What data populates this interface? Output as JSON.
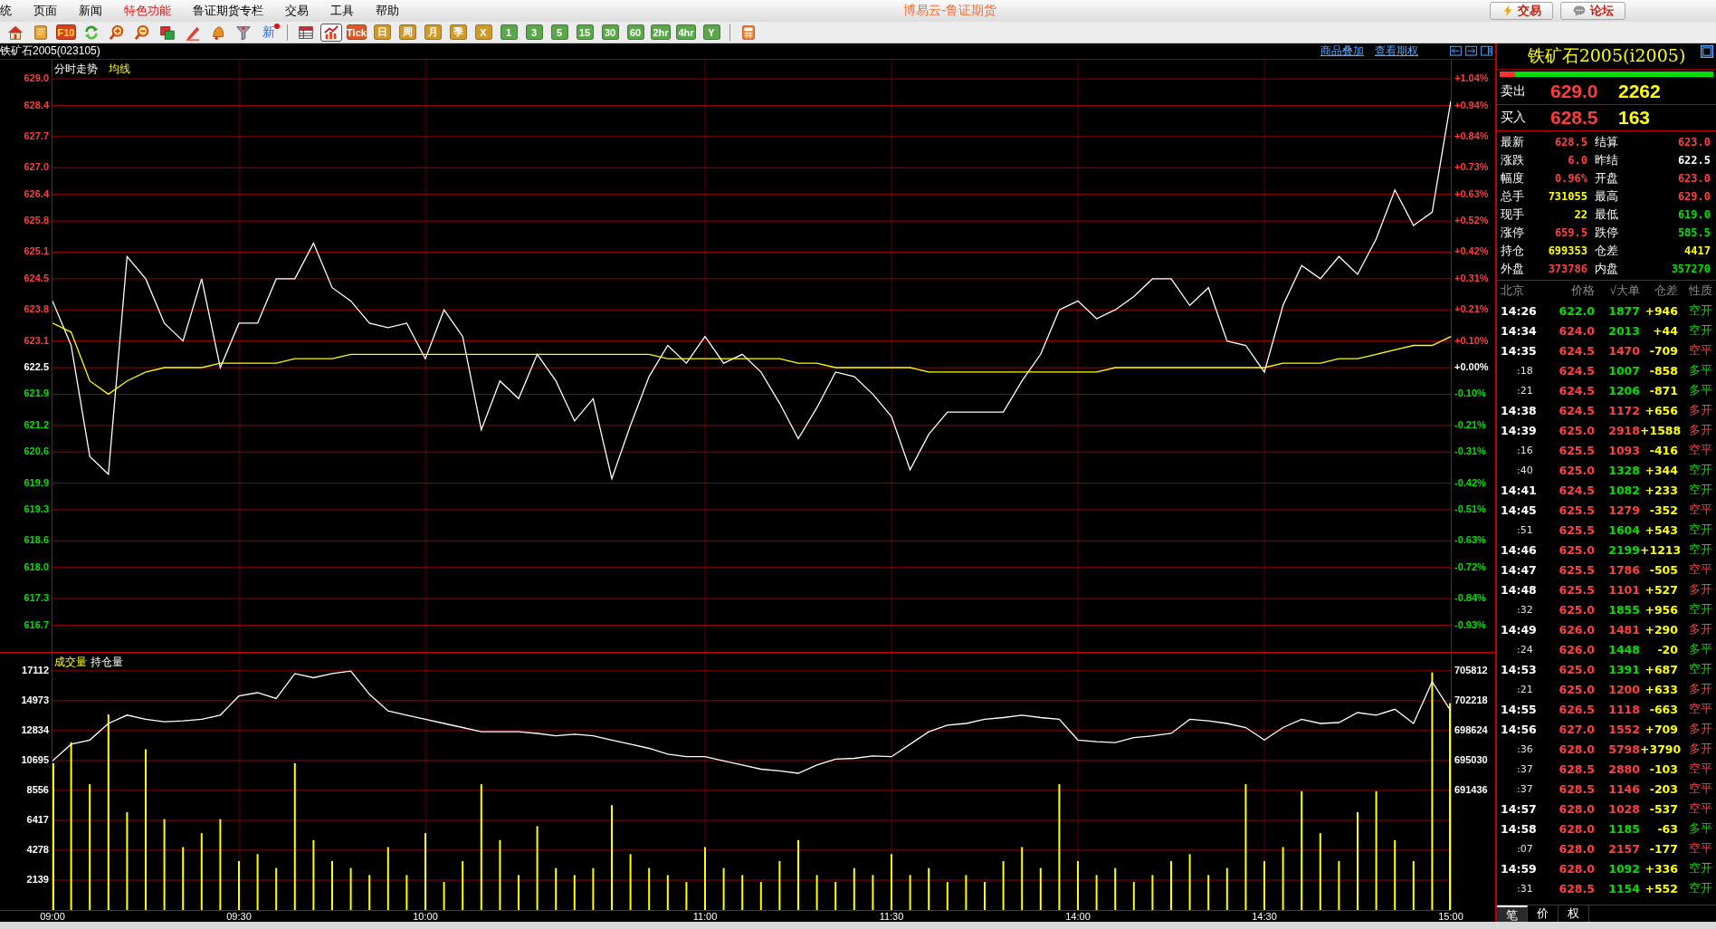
{
  "menu": [
    {
      "label": "统",
      "selected": false
    },
    {
      "label": "页面",
      "selected": false
    },
    {
      "label": "新闻",
      "selected": false
    },
    {
      "label": "特色功能",
      "selected": true
    },
    {
      "label": "鲁证期货专栏",
      "selected": false
    },
    {
      "label": "交易",
      "selected": false
    },
    {
      "label": "工具",
      "selected": false
    },
    {
      "label": "帮助",
      "selected": false
    }
  ],
  "app_title": "博易云-鲁证期货",
  "top_buttons": [
    {
      "kind": "trade",
      "label": "交易"
    },
    {
      "kind": "forum",
      "label": "论坛"
    }
  ],
  "toolbar": [
    {
      "kind": "icon",
      "selected": false
    },
    {
      "kind": "icon",
      "selected": false
    },
    {
      "kind": "f10",
      "label": "F10",
      "selected": false
    },
    {
      "kind": "icon",
      "selected": false
    },
    {
      "kind": "icon",
      "selected": false
    },
    {
      "kind": "icon",
      "selected": false
    },
    {
      "kind": "icon",
      "selected": false
    },
    {
      "kind": "icon",
      "selected": false
    },
    {
      "kind": "icon",
      "selected": false
    },
    {
      "kind": "icon",
      "selected": false
    },
    {
      "kind": "new",
      "label": "新",
      "selected": false
    },
    {
      "kind": "separator"
    },
    {
      "kind": "icon",
      "selected": false
    },
    {
      "kind": "icon",
      "selected": true
    },
    {
      "kind": "tick",
      "label": "Tick",
      "selected": false
    },
    {
      "kind": "period",
      "label": "日",
      "selected": false
    },
    {
      "kind": "period",
      "label": "周",
      "selected": false
    },
    {
      "kind": "period",
      "label": "月",
      "selected": false
    },
    {
      "kind": "period",
      "label": "季",
      "selected": false
    },
    {
      "kind": "period",
      "label": "X",
      "selected": false
    },
    {
      "kind": "minute",
      "label": "1",
      "selected": false
    },
    {
      "kind": "minute",
      "label": "3",
      "selected": false
    },
    {
      "kind": "minute",
      "label": "5",
      "selected": false
    },
    {
      "kind": "minute",
      "label": "15",
      "selected": false
    },
    {
      "kind": "minute",
      "label": "30",
      "selected": false
    },
    {
      "kind": "minute",
      "label": "60",
      "selected": false
    },
    {
      "kind": "minute",
      "label": "2hr",
      "selected": false
    },
    {
      "kind": "minute",
      "label": "4hr",
      "selected": false
    },
    {
      "kind": "minute",
      "label": "Y",
      "selected": false
    },
    {
      "kind": "separator"
    },
    {
      "kind": "icon",
      "selected": false
    }
  ],
  "chart_header": {
    "symbol": "铁矿石2005(023105)",
    "links": [
      "商品叠加",
      "查看期权"
    ]
  },
  "price_panel": {
    "chart_data": {
      "type": "line",
      "grid": true,
      "ylim": [
        616.1,
        629.43
      ],
      "yticks": [
        {
          "value": 629.0,
          "label": "629.0"
        },
        {
          "value": 628.4,
          "label": "628.4"
        },
        {
          "value": 627.7,
          "label": "627.7"
        },
        {
          "value": 627.0,
          "label": "627.0"
        },
        {
          "value": 626.4,
          "label": "626.4"
        },
        {
          "value": 625.8,
          "label": "625.8"
        },
        {
          "value": 625.1,
          "label": "625.1"
        },
        {
          "value": 624.5,
          "label": "624.5"
        },
        {
          "value": 623.8,
          "label": "623.8"
        },
        {
          "value": 623.1,
          "label": "623.1"
        },
        {
          "value": 622.5,
          "label": "622.5"
        },
        {
          "value": 621.9,
          "label": "621.9"
        },
        {
          "value": 621.2,
          "label": "621.2"
        },
        {
          "value": 620.6,
          "label": "620.6"
        },
        {
          "value": 619.9,
          "label": "619.9"
        },
        {
          "value": 619.3,
          "label": "619.3"
        },
        {
          "value": 618.6,
          "label": "618.6"
        },
        {
          "value": 618.0,
          "label": "618.0"
        },
        {
          "value": 617.3,
          "label": "617.3"
        },
        {
          "value": 616.7,
          "label": "616.7"
        }
      ],
      "series": [
        {
          "name": "分时走势",
          "color": "#ffffff",
          "values": [
            624.0,
            623.0,
            620.5,
            620.1,
            625.0,
            624.5,
            623.5,
            623.1,
            624.5,
            622.5,
            623.5,
            623.5,
            624.5,
            624.5,
            625.3,
            624.3,
            624.0,
            623.5,
            623.4,
            623.5,
            622.7,
            623.8,
            623.2,
            621.1,
            622.2,
            621.8,
            622.8,
            622.2,
            621.3,
            621.8,
            620.0,
            621.2,
            622.3,
            623.0,
            622.6,
            623.2,
            622.6,
            622.8,
            622.4,
            621.7,
            620.9,
            621.6,
            622.4,
            622.3,
            621.9,
            621.4,
            620.2,
            621.0,
            621.5,
            621.5,
            621.5,
            621.5,
            622.2,
            622.8,
            623.8,
            624.0,
            623.6,
            623.8,
            624.1,
            624.5,
            624.5,
            623.9,
            624.3,
            623.1,
            623.0,
            622.4,
            623.9,
            624.8,
            624.5,
            625.0,
            624.6,
            625.4,
            626.5,
            625.7,
            626.0,
            628.5
          ]
        },
        {
          "name": "均线",
          "color": "#ffff00",
          "values": [
            623.5,
            623.3,
            622.2,
            621.9,
            622.2,
            622.4,
            622.5,
            622.5,
            622.5,
            622.6,
            622.6,
            622.6,
            622.6,
            622.7,
            622.7,
            622.7,
            622.8,
            622.8,
            622.8,
            622.8,
            622.8,
            622.8,
            622.8,
            622.8,
            622.8,
            622.8,
            622.8,
            622.8,
            622.8,
            622.8,
            622.8,
            622.8,
            622.8,
            622.7,
            622.7,
            622.7,
            622.7,
            622.7,
            622.7,
            622.7,
            622.6,
            622.6,
            622.5,
            622.5,
            622.5,
            622.5,
            622.5,
            622.4,
            622.4,
            622.4,
            622.4,
            622.4,
            622.4,
            622.4,
            622.4,
            622.4,
            622.4,
            622.5,
            622.5,
            622.5,
            622.5,
            622.5,
            622.5,
            622.5,
            622.5,
            622.5,
            622.6,
            622.6,
            622.6,
            622.7,
            622.7,
            622.8,
            622.9,
            623.0,
            623.0,
            623.2
          ]
        }
      ]
    },
    "percent_ticks": [
      {
        "label": "+1.04%",
        "color": "#ff3c3c"
      },
      {
        "label": "+0.94%",
        "color": "#ff3c3c"
      },
      {
        "label": "+0.84%",
        "color": "#ff3c3c"
      },
      {
        "label": "+0.73%",
        "color": "#ff3c3c"
      },
      {
        "label": "+0.63%",
        "color": "#ff3c3c"
      },
      {
        "label": "+0.52%",
        "color": "#ff3c3c"
      },
      {
        "label": "+0.42%",
        "color": "#ff3c3c"
      },
      {
        "label": "+0.31%",
        "color": "#ff3c3c"
      },
      {
        "label": "+0.21%",
        "color": "#ff3c3c"
      },
      {
        "label": "+0.10%",
        "color": "#ff3c3c"
      },
      {
        "label": "+0.00%",
        "color": "#ffffff"
      },
      {
        "label": "-0.10%",
        "color": "#00e000"
      },
      {
        "label": "-0.21%",
        "color": "#00e000"
      },
      {
        "label": "-0.31%",
        "color": "#00e000"
      },
      {
        "label": "-0.42%",
        "color": "#00e000"
      },
      {
        "label": "-0.51%",
        "color": "#00e000"
      },
      {
        "label": "-0.63%",
        "color": "#00e000"
      },
      {
        "label": "-0.72%",
        "color": "#00e000"
      },
      {
        "label": "-0.84%",
        "color": "#00e000"
      },
      {
        "label": "-0.93%",
        "color": "#00e000"
      }
    ]
  },
  "volume_panel": {
    "chart_data": {
      "type": "bar",
      "grid": true,
      "ylim": [
        0,
        18400
      ],
      "categories": [
        "09:00",
        null,
        null,
        null,
        null,
        null,
        null,
        null,
        null,
        null,
        "09:30",
        null,
        null,
        null,
        null,
        null,
        null,
        null,
        null,
        null,
        "10:00",
        null,
        null,
        null,
        null,
        null,
        null,
        null,
        null,
        null,
        null,
        null,
        null,
        null,
        null,
        "11:00",
        null,
        null,
        null,
        null,
        null,
        null,
        null,
        null,
        null,
        "11:30",
        null,
        null,
        null,
        null,
        null,
        null,
        null,
        null,
        null,
        "14:00",
        null,
        null,
        null,
        null,
        null,
        null,
        null,
        null,
        null,
        "14:30",
        null,
        null,
        null,
        null,
        null,
        null,
        null,
        null,
        null,
        "15:00"
      ],
      "yticks": [
        17112,
        14973,
        12834,
        10695,
        8556,
        6417,
        4278,
        2139
      ],
      "series": [
        {
          "name": "成交量",
          "color": "#ffff00",
          "values": [
            10500,
            12000,
            9000,
            14000,
            7000,
            11500,
            6500,
            4500,
            5500,
            6500,
            3500,
            4000,
            3000,
            10500,
            5000,
            3500,
            3000,
            2500,
            4500,
            2500,
            5500,
            2000,
            3500,
            9000,
            5000,
            2500,
            6000,
            3000,
            2500,
            3000,
            7500,
            4000,
            3000,
            2500,
            2000,
            4500,
            3000,
            2500,
            2000,
            3500,
            5000,
            2500,
            2000,
            3000,
            2500,
            4000,
            2500,
            3000,
            2000,
            2500,
            2000,
            3500,
            4500,
            3000,
            9000,
            3500,
            2500,
            3000,
            2000,
            2500,
            3500,
            4000,
            2500,
            3000,
            9000,
            3500,
            4500,
            8500,
            5500,
            3500,
            7000,
            8500,
            5000,
            3500,
            17000,
            14800
          ]
        }
      ]
    },
    "open_interest": {
      "chart_data": {
        "type": "line",
        "ylim": [
          677060,
          707990
        ],
        "yticks": [
          705812,
          702218,
          698624,
          695030,
          691436
        ],
        "series": [
          {
            "name": "持仓量",
            "color": "#ffffff",
            "values": [
              695000,
              697000,
              697500,
              699500,
              700500,
              700000,
              699700,
              699800,
              700000,
              700500,
              702800,
              703200,
              702500,
              705500,
              705000,
              705500,
              705800,
              703000,
              701000,
              700500,
              700000,
              699500,
              699000,
              698500,
              698500,
              698500,
              698300,
              698000,
              698200,
              698000,
              697500,
              697000,
              696500,
              695800,
              695500,
              695500,
              695000,
              694500,
              694000,
              693800,
              693500,
              694500,
              695200,
              695300,
              695600,
              695500,
              697000,
              698500,
              699300,
              699500,
              700000,
              700200,
              700500,
              700200,
              700000,
              697500,
              697300,
              697200,
              697800,
              698000,
              698300,
              700000,
              699800,
              699500,
              699000,
              697500,
              699000,
              700000,
              699500,
              699600,
              700800,
              700500,
              701200,
              699500,
              704500,
              701000
            ]
          }
        ]
      }
    }
  },
  "quote": {
    "title": "铁矿石2005(i2005)",
    "ratio": {
      "level": 0.07
    },
    "ask": {
      "label": "卖出",
      "price": "629.0",
      "volume": "2262"
    },
    "bid": {
      "label": "买入",
      "price": "628.5",
      "volume": "163"
    },
    "stats": [
      {
        "label": "最新",
        "value": "628.5",
        "color": "#ff4040"
      },
      {
        "label": "结算",
        "value": "623.0",
        "color": "#ff4040"
      },
      {
        "label": "涨跌",
        "value": "6.0",
        "color": "#ff4040"
      },
      {
        "label": "昨结",
        "value": "622.5",
        "color": "#ffffff"
      },
      {
        "label": "幅度",
        "value": "0.96%",
        "color": "#ff4040"
      },
      {
        "label": "开盘",
        "value": "623.0",
        "color": "#ff4040"
      },
      {
        "label": "总手",
        "value": "731055",
        "color": "#ffff00"
      },
      {
        "label": "最高",
        "value": "629.0",
        "color": "#ff4040"
      },
      {
        "label": "现手",
        "value": "22",
        "color": "#ffff00"
      },
      {
        "label": "最低",
        "value": "619.0",
        "color": "#00e000"
      },
      {
        "label": "涨停",
        "value": "659.5",
        "color": "#ff4040"
      },
      {
        "label": "跌停",
        "value": "585.5",
        "color": "#00e000"
      },
      {
        "label": "持仓",
        "value": "699353",
        "color": "#ffff00"
      },
      {
        "label": "仓差",
        "value": "4417",
        "color": "#ffff00"
      },
      {
        "label": "外盘",
        "value": "373786",
        "color": "#ff4040"
      },
      {
        "label": "内盘",
        "value": "357270",
        "color": "#00e000"
      }
    ],
    "trades_header": [
      "北京",
      "价格",
      "√大单",
      "仓差",
      "性质"
    ],
    "trades": [
      {
        "kind": "minute",
        "time": "14:26",
        "price": "622.0",
        "price_up": false,
        "volume": "1877",
        "change": "+946",
        "nature": "空开",
        "color": "#00e000"
      },
      {
        "kind": "minute",
        "time": "14:34",
        "price": "624.0",
        "price_up": true,
        "volume": "2013",
        "change": "+44",
        "nature": "空开",
        "color": "#00e000"
      },
      {
        "kind": "minute",
        "time": "14:35",
        "price": "624.5",
        "price_up": true,
        "volume": "1470",
        "change": "-709",
        "nature": "空平",
        "color": "#ff4040"
      },
      {
        "kind": "second",
        "time": ":18",
        "price": "624.5",
        "price_up": true,
        "volume": "1007",
        "change": "-858",
        "nature": "多平",
        "color": "#00e000"
      },
      {
        "kind": "second",
        "time": ":21",
        "price": "624.5",
        "price_up": true,
        "volume": "1206",
        "change": "-871",
        "nature": "多平",
        "color": "#00e000"
      },
      {
        "kind": "minute",
        "time": "14:38",
        "price": "624.5",
        "price_up": true,
        "volume": "1172",
        "change": "+656",
        "nature": "多开",
        "color": "#ff4040"
      },
      {
        "kind": "minute",
        "time": "14:39",
        "price": "625.0",
        "price_up": true,
        "volume": "2918",
        "change": "+1588",
        "nature": "多开",
        "color": "#ff4040"
      },
      {
        "kind": "second",
        "time": ":16",
        "price": "625.5",
        "price_up": true,
        "volume": "1093",
        "change": "-416",
        "nature": "空平",
        "color": "#ff4040"
      },
      {
        "kind": "second",
        "time": ":40",
        "price": "625.0",
        "price_up": true,
        "volume": "1328",
        "change": "+344",
        "nature": "空开",
        "color": "#00e000"
      },
      {
        "kind": "minute",
        "time": "14:41",
        "price": "624.5",
        "price_up": true,
        "volume": "1082",
        "change": "+233",
        "nature": "空开",
        "color": "#00e000"
      },
      {
        "kind": "minute",
        "time": "14:45",
        "price": "625.5",
        "price_up": true,
        "volume": "1279",
        "change": "-352",
        "nature": "空平",
        "color": "#ff4040"
      },
      {
        "kind": "second",
        "time": ":51",
        "price": "625.5",
        "price_up": true,
        "volume": "1604",
        "change": "+543",
        "nature": "空开",
        "color": "#00e000"
      },
      {
        "kind": "minute",
        "time": "14:46",
        "price": "625.0",
        "price_up": true,
        "volume": "2199",
        "change": "+1213",
        "nature": "空开",
        "color": "#00e000"
      },
      {
        "kind": "minute",
        "time": "14:47",
        "price": "625.5",
        "price_up": true,
        "volume": "1786",
        "change": "-505",
        "nature": "空平",
        "color": "#ff4040"
      },
      {
        "kind": "minute",
        "time": "14:48",
        "price": "625.5",
        "price_up": true,
        "volume": "1101",
        "change": "+527",
        "nature": "多开",
        "color": "#ff4040"
      },
      {
        "kind": "second",
        "time": ":32",
        "price": "625.0",
        "price_up": true,
        "volume": "1855",
        "change": "+956",
        "nature": "空开",
        "color": "#00e000"
      },
      {
        "kind": "minute",
        "time": "14:49",
        "price": "626.0",
        "price_up": true,
        "volume": "1481",
        "change": "+290",
        "nature": "多开",
        "color": "#ff4040"
      },
      {
        "kind": "second",
        "time": ":24",
        "price": "626.0",
        "price_up": true,
        "volume": "1448",
        "change": "-20",
        "nature": "多平",
        "color": "#00e000"
      },
      {
        "kind": "minute",
        "time": "14:53",
        "price": "625.0",
        "price_up": true,
        "volume": "1391",
        "change": "+687",
        "nature": "空开",
        "color": "#00e000"
      },
      {
        "kind": "second",
        "time": ":21",
        "price": "625.0",
        "price_up": true,
        "volume": "1200",
        "change": "+633",
        "nature": "多开",
        "color": "#ff4040"
      },
      {
        "kind": "minute",
        "time": "14:55",
        "price": "626.5",
        "price_up": true,
        "volume": "1118",
        "change": "-663",
        "nature": "空平",
        "color": "#ff4040"
      },
      {
        "kind": "minute",
        "time": "14:56",
        "price": "627.0",
        "price_up": true,
        "volume": "1552",
        "change": "+709",
        "nature": "多开",
        "color": "#ff4040"
      },
      {
        "kind": "second",
        "time": ":36",
        "price": "628.0",
        "price_up": true,
        "volume": "5798",
        "change": "+3790",
        "nature": "多开",
        "color": "#ff4040"
      },
      {
        "kind": "second",
        "time": ":37",
        "price": "628.5",
        "price_up": true,
        "volume": "2880",
        "change": "-103",
        "nature": "空平",
        "color": "#ff4040"
      },
      {
        "kind": "second",
        "time": ":37",
        "price": "628.5",
        "price_up": true,
        "volume": "1146",
        "change": "-203",
        "nature": "空平",
        "color": "#ff4040"
      },
      {
        "kind": "minute",
        "time": "14:57",
        "price": "628.0",
        "price_up": true,
        "volume": "1028",
        "change": "-537",
        "nature": "空平",
        "color": "#ff4040"
      },
      {
        "kind": "minute",
        "time": "14:58",
        "price": "628.0",
        "price_up": true,
        "volume": "1185",
        "change": "-63",
        "nature": "多平",
        "color": "#00e000"
      },
      {
        "kind": "second",
        "time": ":07",
        "price": "628.0",
        "price_up": true,
        "volume": "2157",
        "change": "-177",
        "nature": "空平",
        "color": "#ff4040"
      },
      {
        "kind": "minute",
        "time": "14:59",
        "price": "628.0",
        "price_up": true,
        "volume": "1092",
        "change": "+336",
        "nature": "空开",
        "color": "#00e000"
      },
      {
        "kind": "second",
        "time": ":31",
        "price": "628.5",
        "price_up": true,
        "volume": "1154",
        "change": "+552",
        "nature": "空开",
        "color": "#00e000"
      }
    ],
    "tabs": [
      {
        "label": "笔",
        "selected": true
      },
      {
        "label": "价",
        "selected": false
      },
      {
        "label": "权",
        "selected": false
      }
    ]
  }
}
